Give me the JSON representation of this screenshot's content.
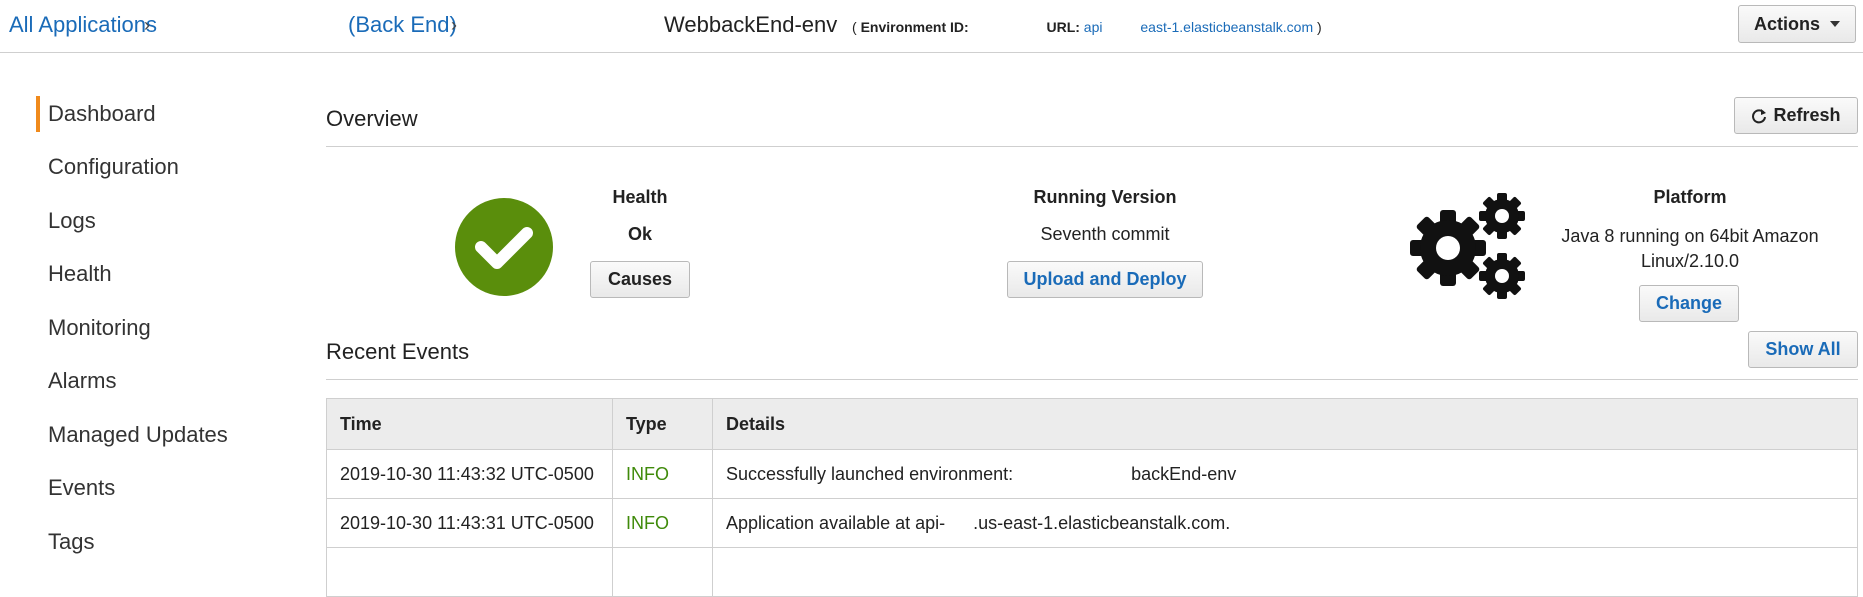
{
  "breadcrumb": {
    "all_applications": "All Applications",
    "application": "(Back End)",
    "environment_name": "WebbackEnd-env",
    "env_id_label": "Environment ID:",
    "url_label": "URL:",
    "url_prefix": "api",
    "url_suffix": "east-1.elasticbeanstalk.com",
    "open_paren": "(",
    "close_paren": ")",
    "separator": "›"
  },
  "actions_button": "Actions",
  "sidebar": {
    "items": [
      {
        "label": "Dashboard",
        "active": true
      },
      {
        "label": "Configuration"
      },
      {
        "label": "Logs"
      },
      {
        "label": "Health"
      },
      {
        "label": "Monitoring"
      },
      {
        "label": "Alarms"
      },
      {
        "label": "Managed Updates"
      },
      {
        "label": "Events"
      },
      {
        "label": "Tags"
      }
    ]
  },
  "overview": {
    "title": "Overview",
    "refresh_button": "Refresh",
    "health": {
      "label": "Health",
      "status": "Ok",
      "button": "Causes"
    },
    "running_version": {
      "label": "Running Version",
      "value": "Seventh commit",
      "button": "Upload and Deploy"
    },
    "platform": {
      "label": "Platform",
      "value": "Java 8 running on 64bit Amazon Linux/2.10.0",
      "button": "Change"
    }
  },
  "recent_events": {
    "title": "Recent Events",
    "show_all_button": "Show All",
    "columns": [
      "Time",
      "Type",
      "Details"
    ],
    "rows": [
      {
        "time": "2019-10-30 11:43:32 UTC-0500",
        "type": "INFO",
        "details_start": "Successfully launched environment:",
        "details_end": "backEnd-env"
      },
      {
        "time": "2019-10-30 11:43:31 UTC-0500",
        "type": "INFO",
        "details_start": "Application available at api-",
        "details_end": ".us-east-1.elasticbeanstalk.com."
      }
    ]
  },
  "colors": {
    "link": "#1a6bb8",
    "active_accent": "#f08a1c",
    "health_ok": "#5a8e0c",
    "info": "#3f8a0a",
    "gear": "#111111"
  },
  "icons": {
    "health": "check-circle-icon",
    "platform": "gears-icon",
    "refresh": "refresh-icon",
    "actions": "caret-down-icon"
  }
}
